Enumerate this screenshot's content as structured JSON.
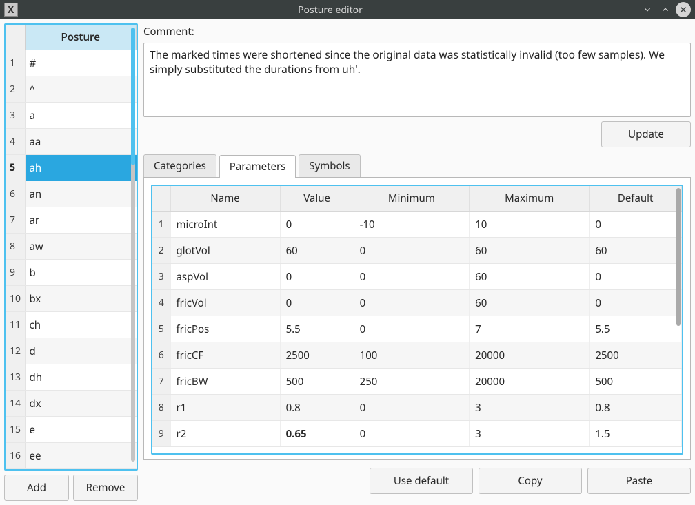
{
  "window": {
    "title": "Posture editor"
  },
  "posture": {
    "header": "Posture",
    "items": [
      "#",
      "^",
      "a",
      "aa",
      "ah",
      "an",
      "ar",
      "aw",
      "b",
      "bx",
      "ch",
      "d",
      "dh",
      "dx",
      "e",
      "ee"
    ],
    "selected_index": 4,
    "add_label": "Add",
    "remove_label": "Remove"
  },
  "comment": {
    "label": "Comment:",
    "text": "The marked times were shortened since the original data was statistically invalid (too few samples). We simply substituted the durations from uh'.",
    "update_label": "Update"
  },
  "tabs": {
    "categories": "Categories",
    "parameters": "Parameters",
    "symbols": "Symbols",
    "active": "parameters"
  },
  "param_table": {
    "headers": {
      "name": "Name",
      "value": "Value",
      "min": "Minimum",
      "max": "Maximum",
      "default": "Default"
    },
    "rows": [
      {
        "name": "microInt",
        "value": "0",
        "min": "-10",
        "max": "10",
        "default": "0"
      },
      {
        "name": "glotVol",
        "value": "60",
        "min": "0",
        "max": "60",
        "default": "60"
      },
      {
        "name": "aspVol",
        "value": "0",
        "min": "0",
        "max": "60",
        "default": "0"
      },
      {
        "name": "fricVol",
        "value": "0",
        "min": "0",
        "max": "60",
        "default": "0"
      },
      {
        "name": "fricPos",
        "value": "5.5",
        "min": "0",
        "max": "7",
        "default": "5.5"
      },
      {
        "name": "fricCF",
        "value": "2500",
        "min": "100",
        "max": "20000",
        "default": "2500"
      },
      {
        "name": "fricBW",
        "value": "500",
        "min": "250",
        "max": "20000",
        "default": "500"
      },
      {
        "name": "r1",
        "value": "0.8",
        "min": "0",
        "max": "3",
        "default": "0.8"
      },
      {
        "name": "r2",
        "value": "0.65",
        "min": "0",
        "max": "3",
        "default": "1.5",
        "bold_value": true
      }
    ]
  },
  "actions": {
    "use_default": "Use default",
    "copy": "Copy",
    "paste": "Paste"
  }
}
